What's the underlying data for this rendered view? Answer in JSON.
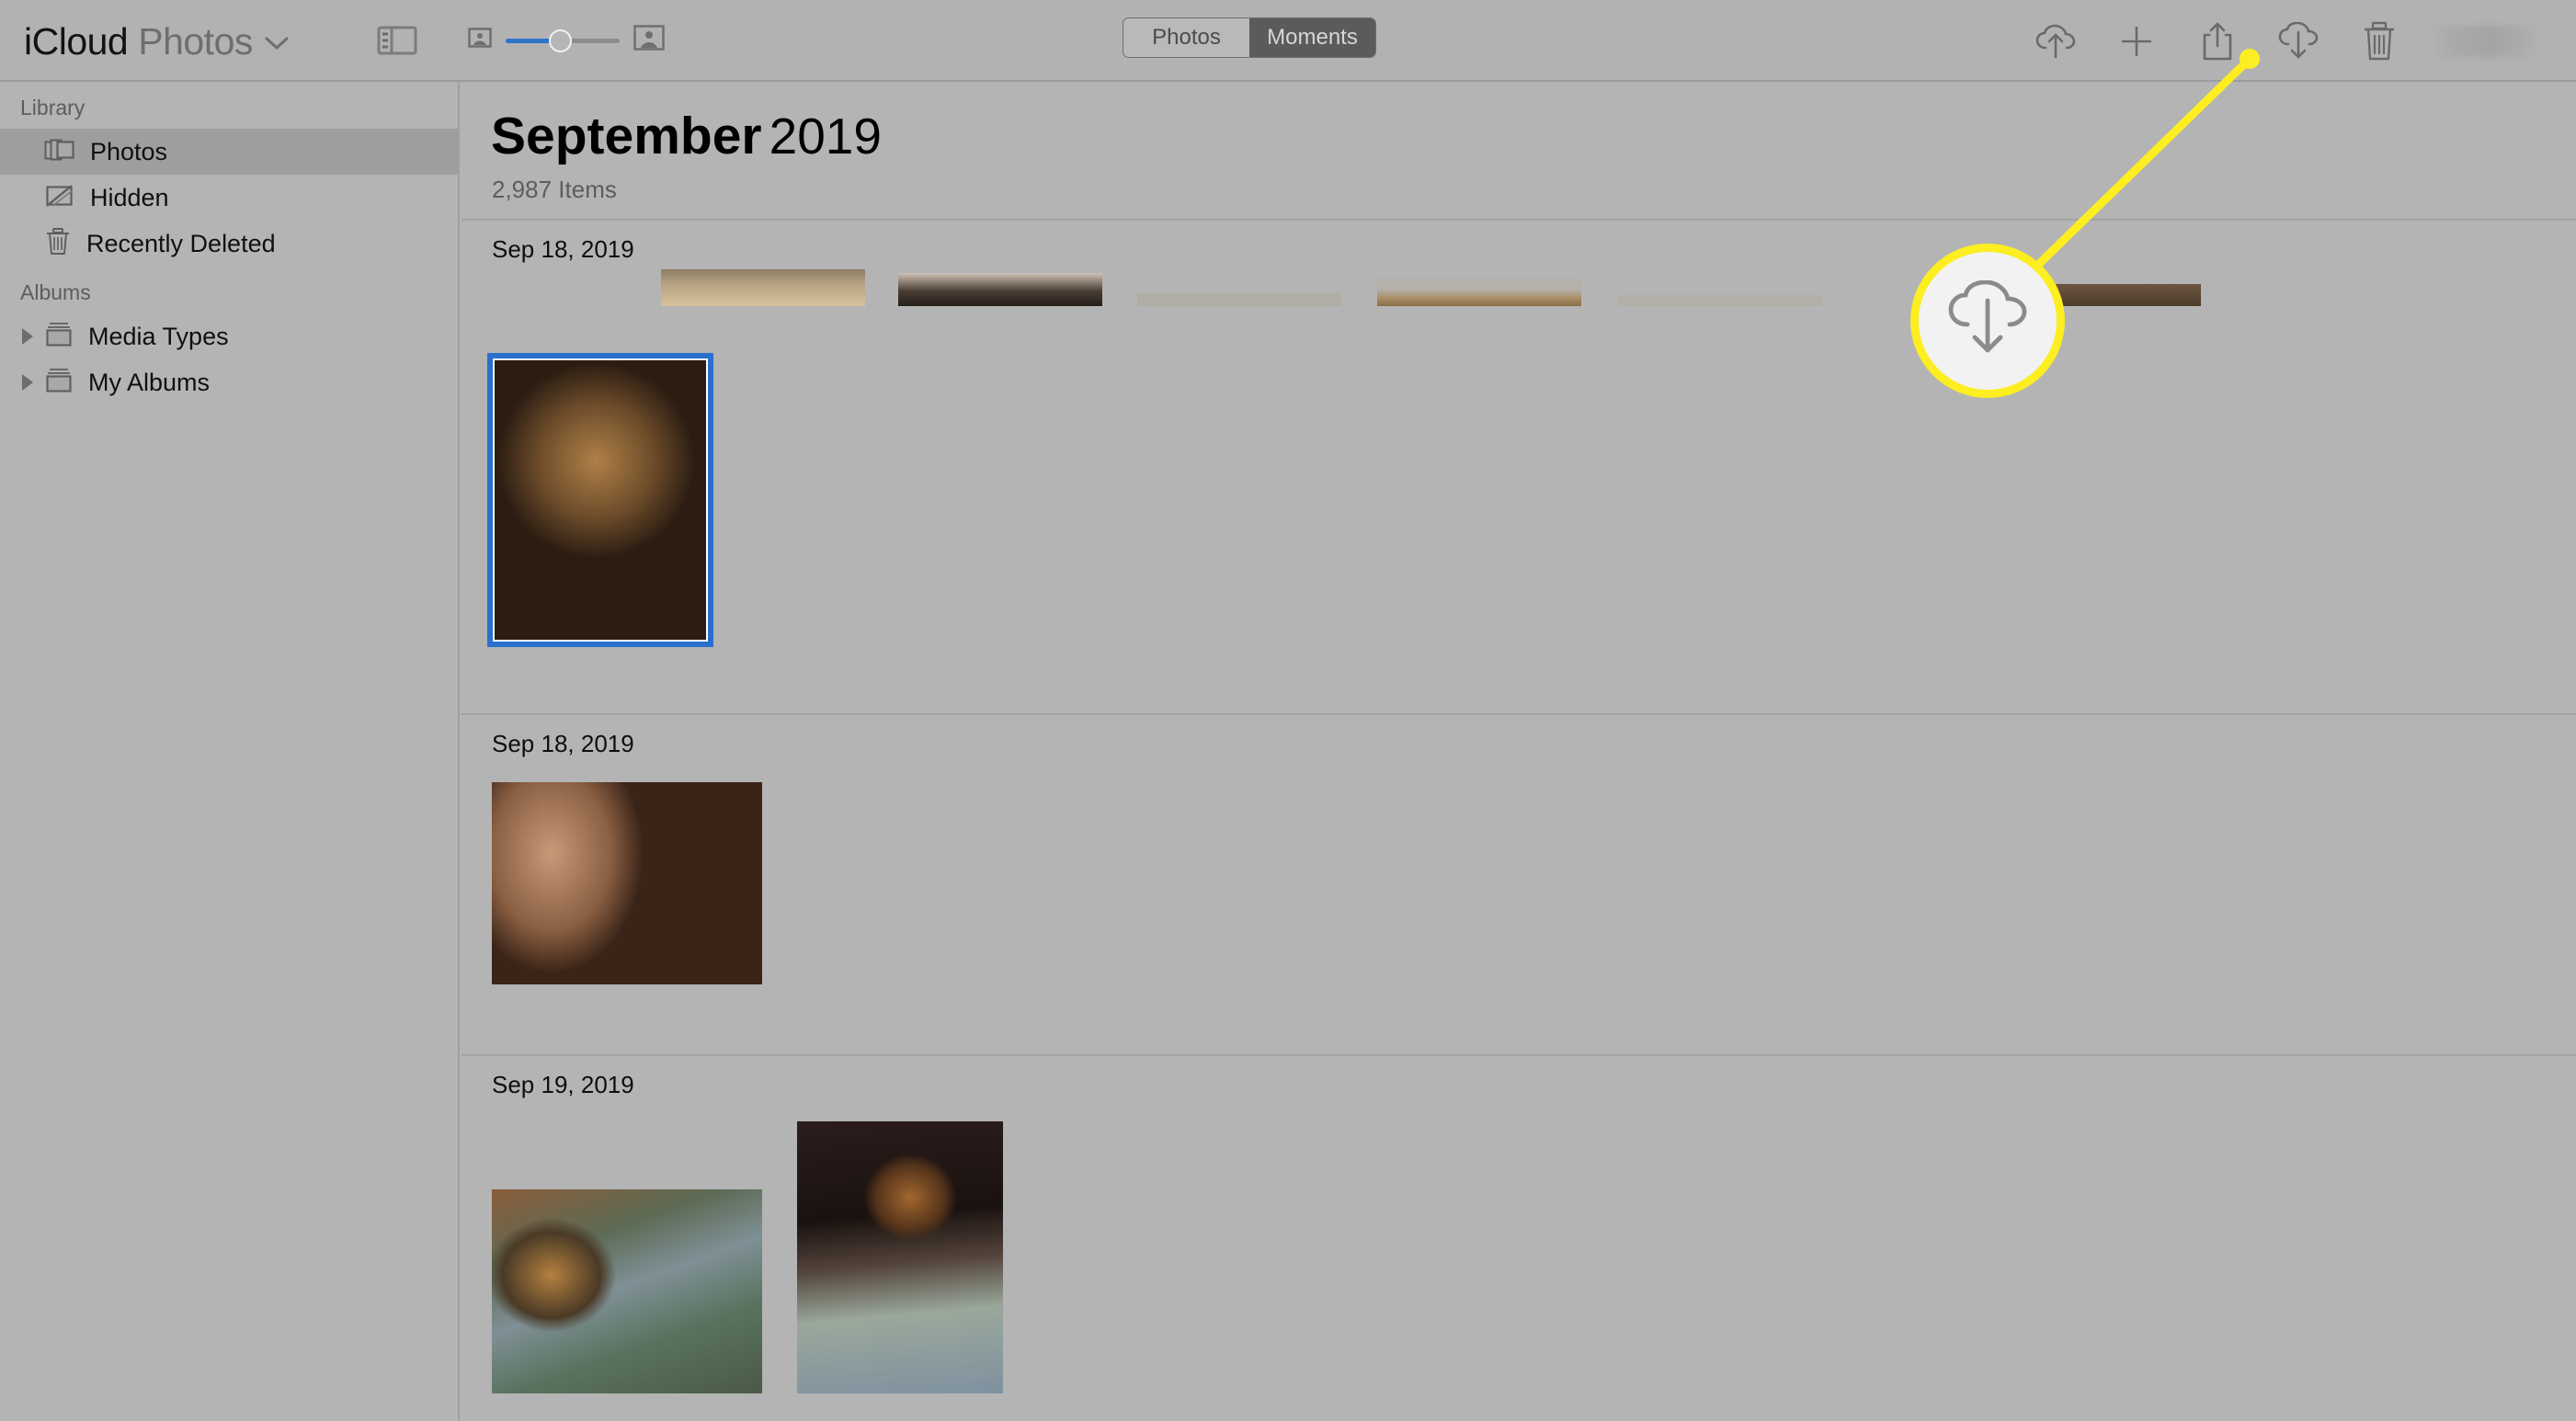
{
  "app": {
    "title_primary": "iCloud",
    "title_secondary": "Photos",
    "title_chevron_icon": "chevron-down-icon"
  },
  "toolbar": {
    "sidebar_toggle_icon": "sidebar-toggle-icon",
    "zoom": {
      "small_icon": "small-thumbnail-icon",
      "large_icon": "large-thumbnail-icon",
      "value_percent": 47
    },
    "view_tabs": [
      {
        "label": "Photos",
        "active": false
      },
      {
        "label": "Moments",
        "active": true
      }
    ],
    "actions": [
      {
        "name": "upload-to-icloud-button",
        "icon": "cloud-upload-icon"
      },
      {
        "name": "add-album-button",
        "icon": "plus-icon"
      },
      {
        "name": "share-button",
        "icon": "share-icon"
      },
      {
        "name": "download-button",
        "icon": "cloud-download-icon"
      },
      {
        "name": "delete-button",
        "icon": "trash-icon"
      }
    ],
    "search": {
      "placeholder": "",
      "value": "",
      "redacted": true
    }
  },
  "sidebar": {
    "sections": [
      {
        "header": "Library",
        "items": [
          {
            "label": "Photos",
            "icon": "photos-stack-icon",
            "selected": true,
            "expandable": false
          },
          {
            "label": "Hidden",
            "icon": "hidden-slash-icon",
            "selected": false,
            "expandable": false
          },
          {
            "label": "Recently Deleted",
            "icon": "trash-icon",
            "selected": false,
            "expandable": false
          }
        ]
      },
      {
        "header": "Albums",
        "items": [
          {
            "label": "Media Types",
            "icon": "album-folder-icon",
            "selected": false,
            "expandable": true
          },
          {
            "label": "My Albums",
            "icon": "album-folder-icon",
            "selected": false,
            "expandable": true
          }
        ]
      }
    ]
  },
  "main": {
    "title_month": "September",
    "title_year": "2019",
    "items_count": "2,987 Items",
    "groups": [
      {
        "date": "Sep 18, 2019",
        "scrolled_partial": true,
        "photos": 6
      },
      {
        "date": "Sep 18, 2019",
        "scrolled_partial": false,
        "photos": 1
      },
      {
        "date": "Sep 19, 2019",
        "scrolled_partial": false,
        "photos": 2
      }
    ]
  },
  "callout": {
    "target_icon": "cloud-download-icon",
    "ring_color": "#fcee21",
    "fill_color": "#f2f2f2"
  },
  "colors": {
    "window_bg": "#b4b4b4",
    "toolbar_bg": "#b2b2b2",
    "selection_blue": "#2a6fce",
    "sidebar_selected": "#9e9e9e",
    "slider_blue": "#2f74c9",
    "segment_active_bg": "#5b5b5b",
    "highlight_yellow": "#fcee21"
  }
}
